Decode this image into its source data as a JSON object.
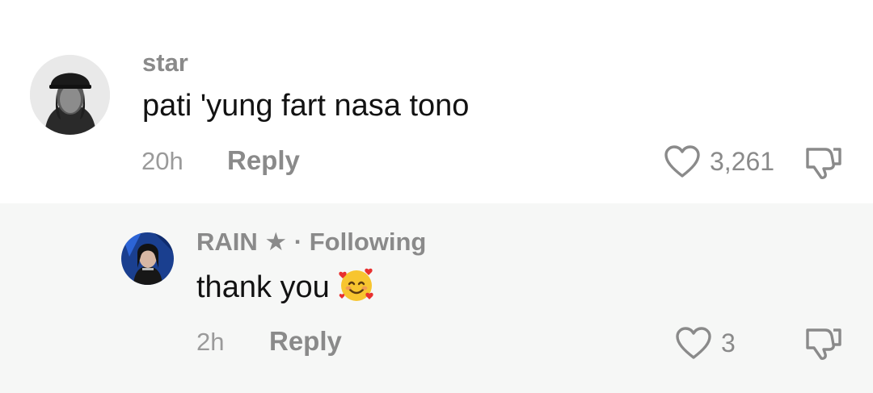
{
  "comments": [
    {
      "username": "star",
      "text": "pati 'yung fart nasa tono",
      "time": "20h",
      "reply_label": "Reply",
      "likes": "3,261"
    }
  ],
  "reply": {
    "username": "RAIN ★ · Following",
    "text": "thank you",
    "emoji_icon": "smiling-face-with-hearts-icon",
    "time": "2h",
    "reply_label": "Reply",
    "likes": "3"
  },
  "colors": {
    "reply_background": "#f6f7f6",
    "secondary_text": "#8a8a8a",
    "primary_text": "#121212"
  }
}
